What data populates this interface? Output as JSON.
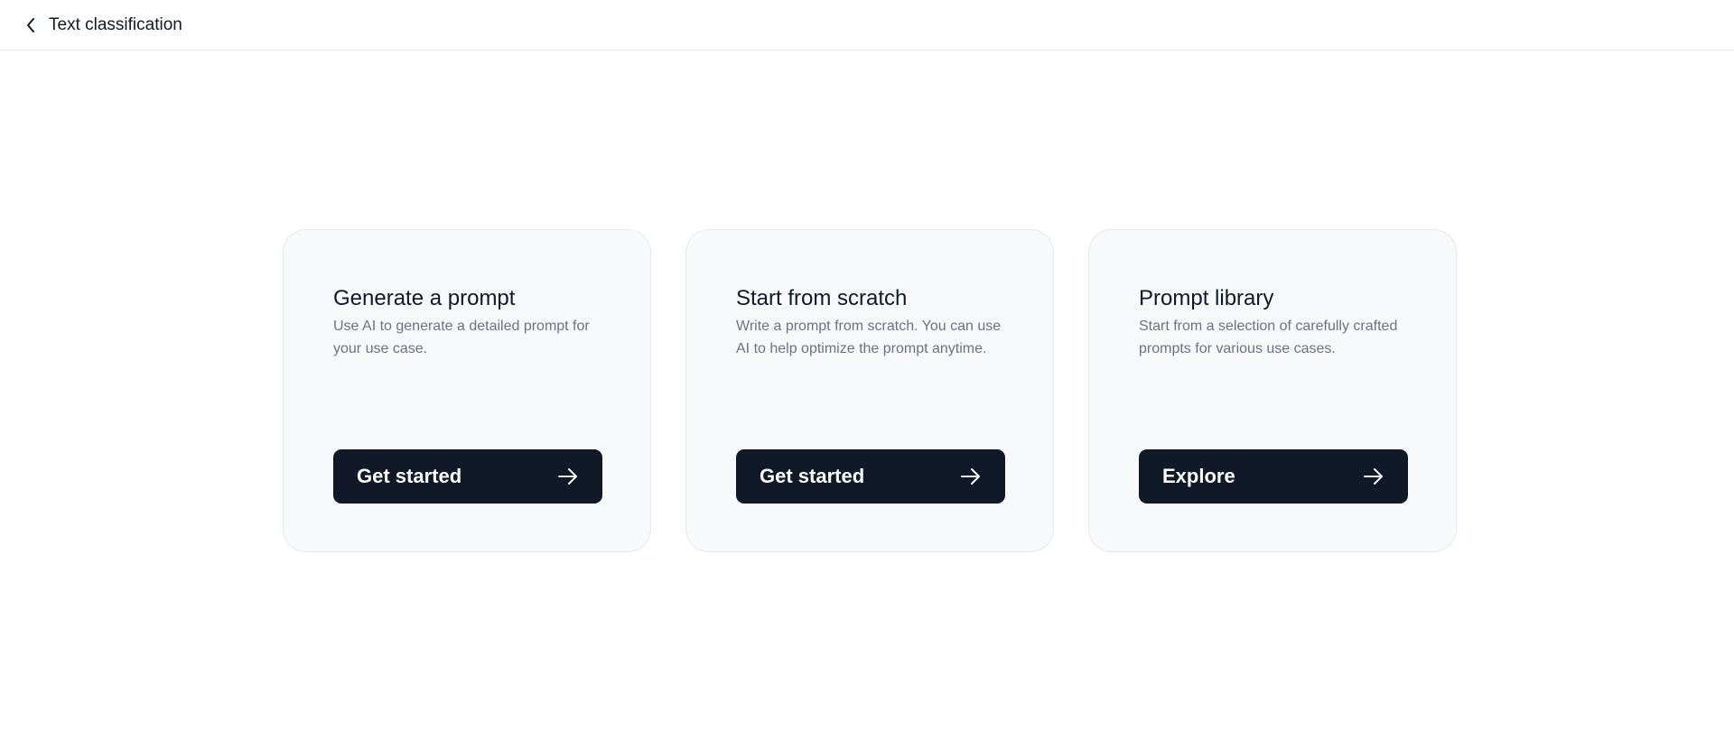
{
  "header": {
    "back_icon": "chevron-left-icon",
    "title": "Text classification"
  },
  "cards": [
    {
      "title": "Generate a prompt",
      "description": "Use AI to generate a detailed prompt for your use case.",
      "button_label": "Get started",
      "button_icon": "arrow-right-icon"
    },
    {
      "title": "Start from scratch",
      "description": "Write a prompt from scratch. You can use AI to help optimize the prompt anytime.",
      "button_label": "Get started",
      "button_icon": "arrow-right-icon"
    },
    {
      "title": "Prompt library",
      "description": "Start from a selection of carefully crafted prompts for various use cases.",
      "button_label": "Explore",
      "button_icon": "arrow-right-icon"
    }
  ],
  "colors": {
    "button_bg": "#111827",
    "card_bg": "#f8f9fb",
    "muted_text": "#6b7280"
  }
}
